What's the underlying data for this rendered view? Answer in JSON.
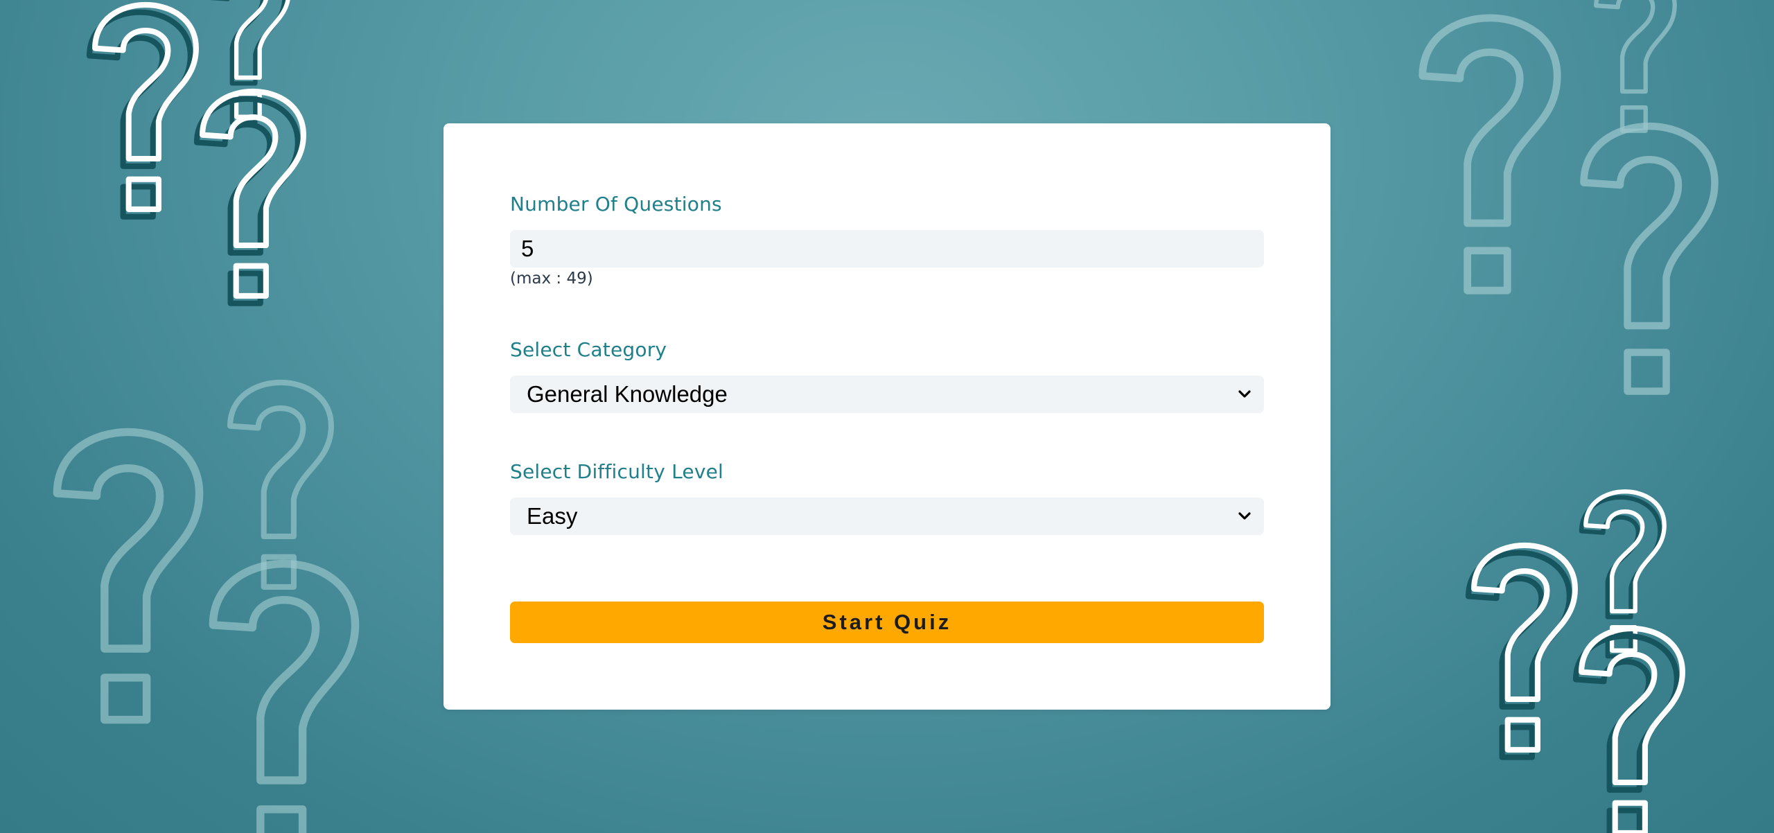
{
  "form": {
    "questions": {
      "label": "Number Of Questions",
      "value": "5",
      "hint": "(max : 49)"
    },
    "category": {
      "label": "Select Category",
      "selected": "General Knowledge"
    },
    "difficulty": {
      "label": "Select Difficulty Level",
      "selected": "Easy"
    },
    "start_button": "Start Quiz"
  },
  "colors": {
    "background": "#4a8f9b",
    "label": "#1f7f8a",
    "button": "#ffa800",
    "field": "#f1f4f6"
  },
  "icons": {
    "background_decoration": "question-mark-icon",
    "select_arrow": "chevron-down-icon"
  }
}
